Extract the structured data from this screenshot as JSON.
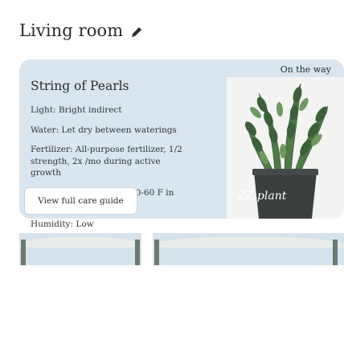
{
  "header": {
    "title": "Living room",
    "edit_icon": "pencil-icon"
  },
  "care_card": {
    "plant_name": "String of Pearls",
    "care_items": [
      "Light: Bright indirect",
      "Water: Let dry between waterings",
      "Fertilizer: All-purpose fertilizer, 1/2 strength, 2x /mo during active growth",
      "Temperature: 70-80 F (60-60 F in winter)",
      "Humidity: Low"
    ],
    "guide_button_label": "View full care guide"
  },
  "photo_card": {
    "status": "On the way",
    "caption": "ZZ plant"
  },
  "colors": {
    "card_background": "#d9e6f0",
    "text": "#2b2b2b",
    "pot": "#3a3f3e",
    "leaf_dark": "#2f4a34",
    "leaf_light": "#5f8a55"
  }
}
